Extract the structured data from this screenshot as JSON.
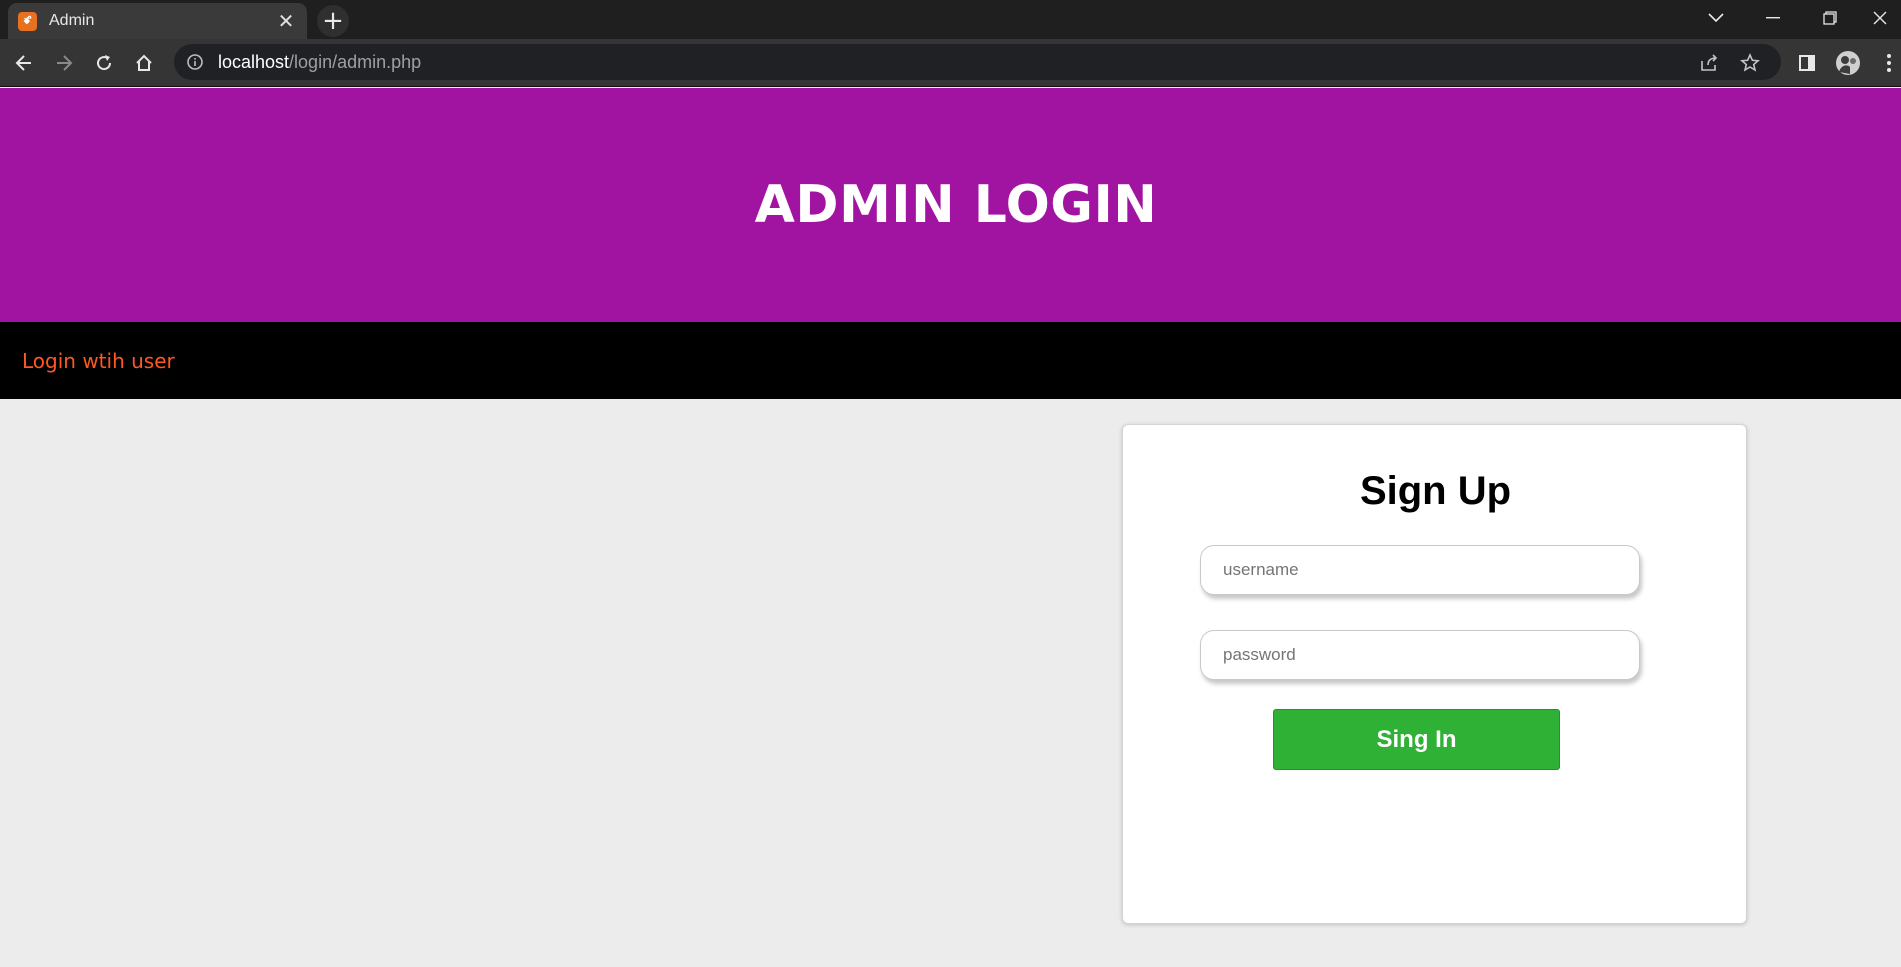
{
  "browser": {
    "tab_title": "Admin",
    "favicon_text": "ꗄ",
    "url_host": "localhost",
    "url_path": "/login/admin.php"
  },
  "page": {
    "header_title": "ADMIN LOGIN",
    "nav_link": "Login wtih user",
    "colors": {
      "header_bg": "#a114a1",
      "nav_bg": "#000000",
      "nav_link": "#ff5722",
      "button_bg": "#2eb135"
    }
  },
  "form": {
    "title": "Sign Up",
    "username_placeholder": "username",
    "password_placeholder": "password",
    "submit_label": "Sing In"
  }
}
